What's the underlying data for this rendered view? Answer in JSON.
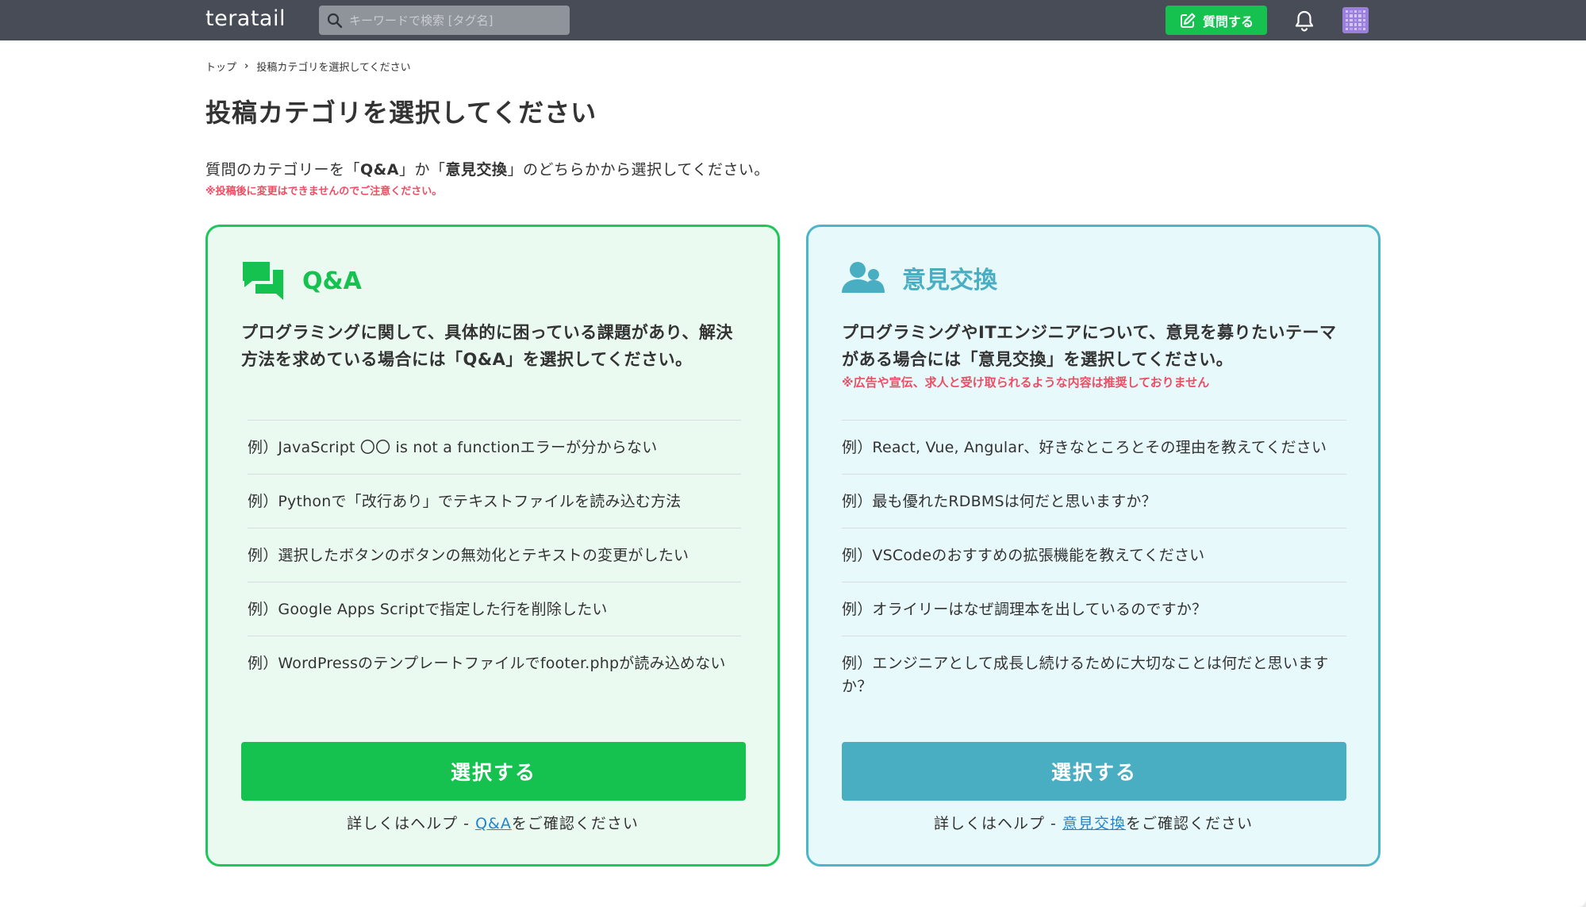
{
  "header": {
    "logo": "teratail",
    "search_placeholder": "キーワードで検索 [タグ名]",
    "ask_label": "質問する"
  },
  "breadcrumb": {
    "home": "トップ",
    "current": "投稿カテゴリを選択してください"
  },
  "page_title": "投稿カテゴリを選択してください",
  "intro": {
    "prefix": "質問のカテゴリーを「",
    "qa": "Q&A",
    "mid": "」か「",
    "opinion": "意見交換",
    "suffix": "」のどちらかから選択してください。"
  },
  "warning": "※投稿後に変更はできませんのでご注意ください。",
  "cards": {
    "qa": {
      "title": "Q&A",
      "description": "プログラミングに関して、具体的に困っている課題があり、解決方法を求めている場合には「Q&A」を選択してください。",
      "examples": [
        "例）JavaScript 〇〇 is not a functionエラーが分からない",
        "例）Pythonで「改行あり」でテキストファイルを読み込む方法",
        "例）選択したボタンのボタンの無効化とテキストの変更がしたい",
        "例）Google Apps Scriptで指定した行を削除したい",
        "例）WordPressのテンプレートファイルでfooter.phpが読み込めない"
      ],
      "select_label": "選択する",
      "help_prefix": "詳しくはヘルプ - ",
      "help_link": "Q&A",
      "help_suffix": "をご確認ください"
    },
    "opinion": {
      "title": "意見交換",
      "description": "プログラミングやITエンジニアについて、意見を募りたいテーマがある場合には「意見交換」を選択してください。",
      "note": "※広告や宣伝、求人と受け取られるような内容は推奨しておりません",
      "examples": [
        "例）React, Vue, Angular、好きなところとその理由を教えてください",
        "例）最も優れたRDBMSは何だと思いますか？",
        "例）VSCodeのおすすめの拡張機能を教えてください",
        "例）オライリーはなぜ調理本を出しているのですか？",
        "例）エンジニアとして成長し続けるために大切なことは何だと思いますか？"
      ],
      "select_label": "選択する",
      "help_prefix": "詳しくはヘルプ - ",
      "help_link": "意見交換",
      "help_suffix": "をご確認ください"
    }
  },
  "colors": {
    "header_bg": "#474c56",
    "qa_accent": "#15c14f",
    "opinion_accent": "#4aaec3",
    "warning": "#ee4d63",
    "link": "#2383cf"
  }
}
